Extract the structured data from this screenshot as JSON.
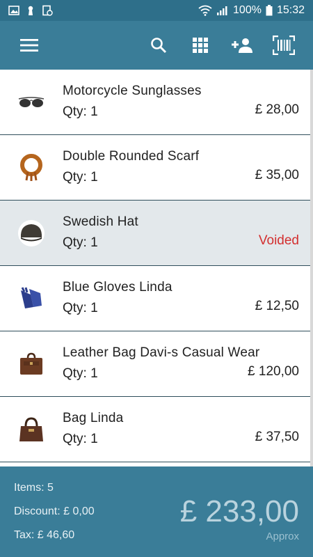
{
  "status": {
    "battery": "100%",
    "time": "15:32"
  },
  "toolbar": {
    "menu_icon": "menu-icon",
    "search_icon": "search-icon",
    "grid_icon": "grid-icon",
    "add_customer_icon": "add-person-icon",
    "barcode_icon": "barcode-scan-icon"
  },
  "items": [
    {
      "name": "Motorcycle Sunglasses",
      "qty": "Qty: 1",
      "price": "£ 28,00",
      "voided": false,
      "icon": "sunglasses-icon"
    },
    {
      "name": "Double Rounded Scarf",
      "qty": "Qty: 1",
      "price": "£ 35,00",
      "voided": false,
      "icon": "scarf-icon"
    },
    {
      "name": "Swedish Hat",
      "qty": "Qty: 1",
      "price": "Voided",
      "voided": true,
      "icon": "hat-icon"
    },
    {
      "name": "Blue Gloves Linda",
      "qty": "Qty: 1",
      "price": "£ 12,50",
      "voided": false,
      "icon": "gloves-icon"
    },
    {
      "name": "Leather Bag Davi-s Casual Wear",
      "qty": "Qty: 1",
      "price": "£ 120,00",
      "voided": false,
      "icon": "leather-bag-icon"
    },
    {
      "name": "Bag Linda",
      "qty": "Qty: 1",
      "price": "£ 37,50",
      "voided": false,
      "icon": "handbag-icon"
    }
  ],
  "summary": {
    "items": "Items: 5",
    "discount": "Discount: £ 0,00",
    "tax": "Tax: £ 46,60",
    "total": "£ 233,00",
    "approx": "Approx"
  },
  "colors": {
    "status_bar": "#2e6f8a",
    "toolbar": "#3a7d98",
    "voided_text": "#d32f2f",
    "voided_row": "#e3e8eb"
  }
}
